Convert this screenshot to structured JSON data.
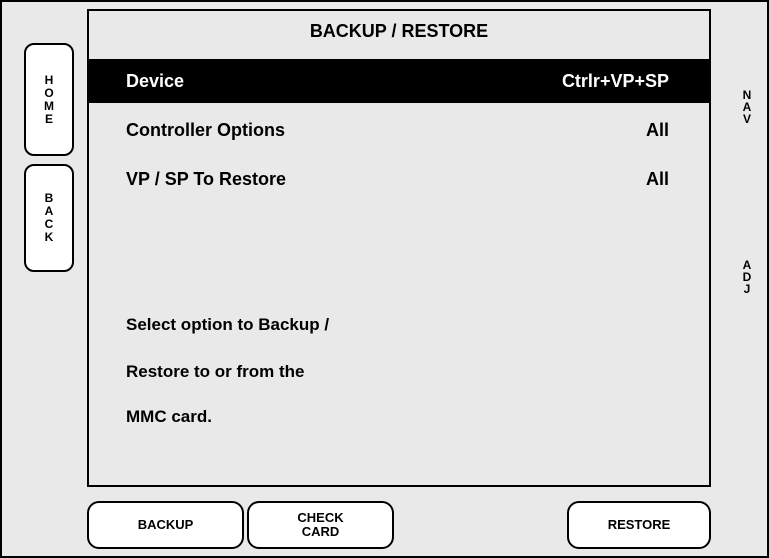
{
  "title": "BACKUP / RESTORE",
  "side_buttons": {
    "home": "HOME",
    "back": "BACK"
  },
  "right_labels": {
    "nav": "NAV",
    "adj": "ADJ"
  },
  "rows": [
    {
      "label": "Device",
      "value": "Ctrlr+VP+SP",
      "selected": true
    },
    {
      "label": "Controller Options",
      "value": "All",
      "selected": false
    },
    {
      "label": "VP / SP To Restore",
      "value": "All",
      "selected": false
    }
  ],
  "message_lines": [
    "Select option to Backup /",
    "Restore to or from the",
    "MMC card."
  ],
  "bottom_buttons": {
    "backup": "BACKUP",
    "check_card": "CHECK CARD",
    "restore": "RESTORE"
  },
  "colors": {
    "background": "#e9e9e9",
    "selected_row": "#000000",
    "selected_text": "#ffffff"
  }
}
